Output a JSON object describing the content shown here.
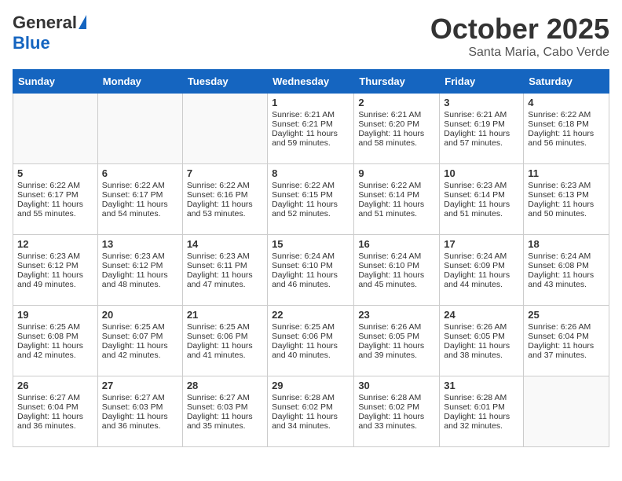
{
  "header": {
    "logo_general": "General",
    "logo_blue": "Blue",
    "month": "October 2025",
    "location": "Santa Maria, Cabo Verde"
  },
  "days_of_week": [
    "Sunday",
    "Monday",
    "Tuesday",
    "Wednesday",
    "Thursday",
    "Friday",
    "Saturday"
  ],
  "weeks": [
    [
      {
        "day": "",
        "info": ""
      },
      {
        "day": "",
        "info": ""
      },
      {
        "day": "",
        "info": ""
      },
      {
        "day": "1",
        "info": "Sunrise: 6:21 AM\nSunset: 6:21 PM\nDaylight: 11 hours and 59 minutes."
      },
      {
        "day": "2",
        "info": "Sunrise: 6:21 AM\nSunset: 6:20 PM\nDaylight: 11 hours and 58 minutes."
      },
      {
        "day": "3",
        "info": "Sunrise: 6:21 AM\nSunset: 6:19 PM\nDaylight: 11 hours and 57 minutes."
      },
      {
        "day": "4",
        "info": "Sunrise: 6:22 AM\nSunset: 6:18 PM\nDaylight: 11 hours and 56 minutes."
      }
    ],
    [
      {
        "day": "5",
        "info": "Sunrise: 6:22 AM\nSunset: 6:17 PM\nDaylight: 11 hours and 55 minutes."
      },
      {
        "day": "6",
        "info": "Sunrise: 6:22 AM\nSunset: 6:17 PM\nDaylight: 11 hours and 54 minutes."
      },
      {
        "day": "7",
        "info": "Sunrise: 6:22 AM\nSunset: 6:16 PM\nDaylight: 11 hours and 53 minutes."
      },
      {
        "day": "8",
        "info": "Sunrise: 6:22 AM\nSunset: 6:15 PM\nDaylight: 11 hours and 52 minutes."
      },
      {
        "day": "9",
        "info": "Sunrise: 6:22 AM\nSunset: 6:14 PM\nDaylight: 11 hours and 51 minutes."
      },
      {
        "day": "10",
        "info": "Sunrise: 6:23 AM\nSunset: 6:14 PM\nDaylight: 11 hours and 51 minutes."
      },
      {
        "day": "11",
        "info": "Sunrise: 6:23 AM\nSunset: 6:13 PM\nDaylight: 11 hours and 50 minutes."
      }
    ],
    [
      {
        "day": "12",
        "info": "Sunrise: 6:23 AM\nSunset: 6:12 PM\nDaylight: 11 hours and 49 minutes."
      },
      {
        "day": "13",
        "info": "Sunrise: 6:23 AM\nSunset: 6:12 PM\nDaylight: 11 hours and 48 minutes."
      },
      {
        "day": "14",
        "info": "Sunrise: 6:23 AM\nSunset: 6:11 PM\nDaylight: 11 hours and 47 minutes."
      },
      {
        "day": "15",
        "info": "Sunrise: 6:24 AM\nSunset: 6:10 PM\nDaylight: 11 hours and 46 minutes."
      },
      {
        "day": "16",
        "info": "Sunrise: 6:24 AM\nSunset: 6:10 PM\nDaylight: 11 hours and 45 minutes."
      },
      {
        "day": "17",
        "info": "Sunrise: 6:24 AM\nSunset: 6:09 PM\nDaylight: 11 hours and 44 minutes."
      },
      {
        "day": "18",
        "info": "Sunrise: 6:24 AM\nSunset: 6:08 PM\nDaylight: 11 hours and 43 minutes."
      }
    ],
    [
      {
        "day": "19",
        "info": "Sunrise: 6:25 AM\nSunset: 6:08 PM\nDaylight: 11 hours and 42 minutes."
      },
      {
        "day": "20",
        "info": "Sunrise: 6:25 AM\nSunset: 6:07 PM\nDaylight: 11 hours and 42 minutes."
      },
      {
        "day": "21",
        "info": "Sunrise: 6:25 AM\nSunset: 6:06 PM\nDaylight: 11 hours and 41 minutes."
      },
      {
        "day": "22",
        "info": "Sunrise: 6:25 AM\nSunset: 6:06 PM\nDaylight: 11 hours and 40 minutes."
      },
      {
        "day": "23",
        "info": "Sunrise: 6:26 AM\nSunset: 6:05 PM\nDaylight: 11 hours and 39 minutes."
      },
      {
        "day": "24",
        "info": "Sunrise: 6:26 AM\nSunset: 6:05 PM\nDaylight: 11 hours and 38 minutes."
      },
      {
        "day": "25",
        "info": "Sunrise: 6:26 AM\nSunset: 6:04 PM\nDaylight: 11 hours and 37 minutes."
      }
    ],
    [
      {
        "day": "26",
        "info": "Sunrise: 6:27 AM\nSunset: 6:04 PM\nDaylight: 11 hours and 36 minutes."
      },
      {
        "day": "27",
        "info": "Sunrise: 6:27 AM\nSunset: 6:03 PM\nDaylight: 11 hours and 36 minutes."
      },
      {
        "day": "28",
        "info": "Sunrise: 6:27 AM\nSunset: 6:03 PM\nDaylight: 11 hours and 35 minutes."
      },
      {
        "day": "29",
        "info": "Sunrise: 6:28 AM\nSunset: 6:02 PM\nDaylight: 11 hours and 34 minutes."
      },
      {
        "day": "30",
        "info": "Sunrise: 6:28 AM\nSunset: 6:02 PM\nDaylight: 11 hours and 33 minutes."
      },
      {
        "day": "31",
        "info": "Sunrise: 6:28 AM\nSunset: 6:01 PM\nDaylight: 11 hours and 32 minutes."
      },
      {
        "day": "",
        "info": ""
      }
    ]
  ]
}
